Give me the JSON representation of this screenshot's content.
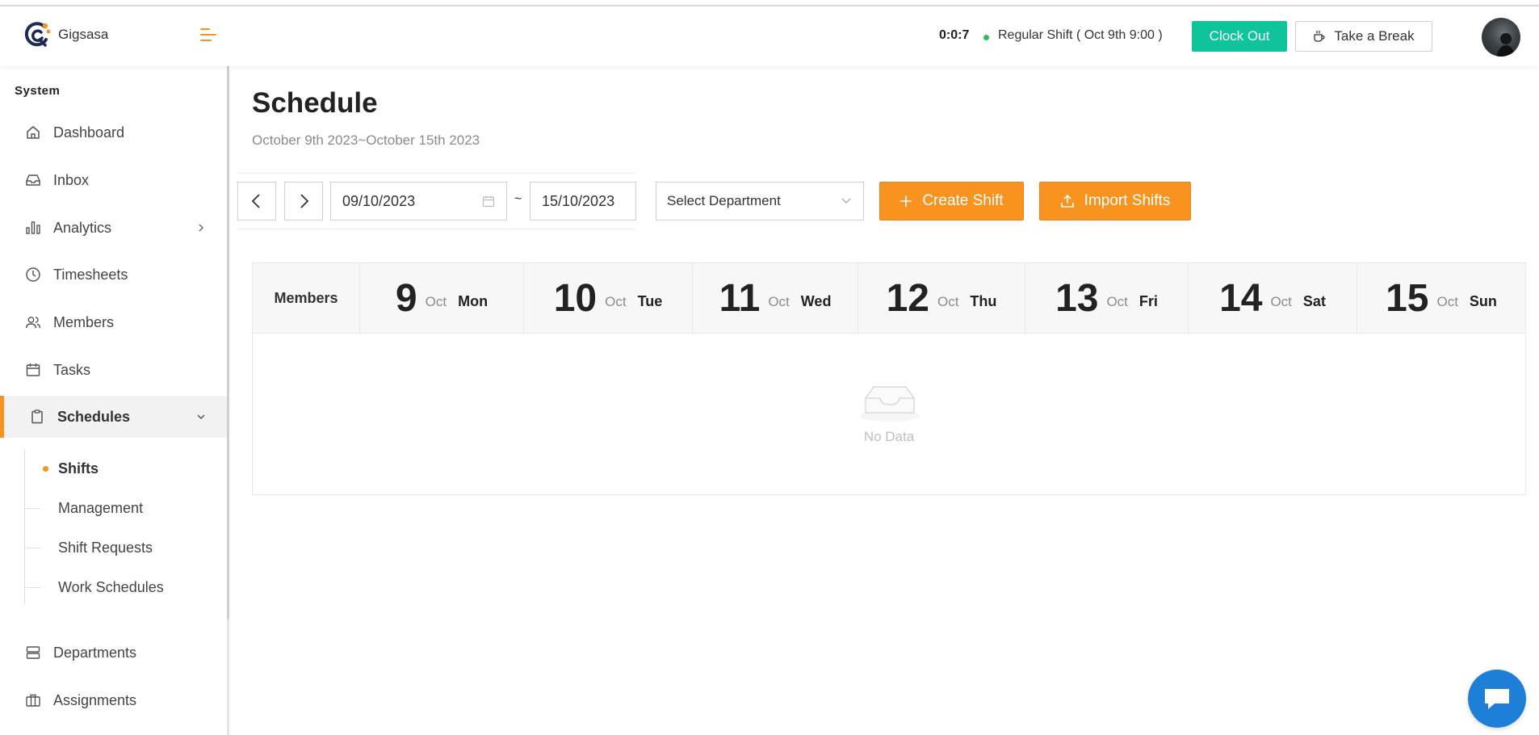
{
  "header": {
    "app_name": "Gigsasa",
    "timer": "0:0:7",
    "shift_label": "Regular Shift ( Oct 9th 9:00 )",
    "clock_out_label": "Clock Out",
    "take_break_label": "Take a Break",
    "accent": "#f7931e",
    "clock_out_color": "#0fc39b"
  },
  "sidebar": {
    "heading": "System",
    "items": [
      {
        "label": "Dashboard",
        "icon": "home-icon"
      },
      {
        "label": "Inbox",
        "icon": "inbox-icon"
      },
      {
        "label": "Analytics",
        "icon": "bar-chart-icon"
      },
      {
        "label": "Timesheets",
        "icon": "clock-icon"
      },
      {
        "label": "Members",
        "icon": "users-icon"
      },
      {
        "label": "Tasks",
        "icon": "calendar-icon"
      },
      {
        "label": "Schedules",
        "icon": "clipboard-icon"
      },
      {
        "label": "Departments",
        "icon": "server-icon"
      },
      {
        "label": "Assignments",
        "icon": "briefcase-icon"
      }
    ],
    "schedules_sub": [
      {
        "label": "Shifts"
      },
      {
        "label": "Management"
      },
      {
        "label": "Shift Requests"
      },
      {
        "label": "Work Schedules"
      }
    ]
  },
  "main": {
    "title": "Schedule",
    "date_range": "October 9th 2023~October 15th 2023",
    "start_date": "09/10/2023",
    "end_date": "15/10/2023",
    "range_separator": "~",
    "department_placeholder": "Select Department",
    "create_shift_label": "Create Shift",
    "import_shifts_label": "Import Shifts"
  },
  "table": {
    "members_header": "Members",
    "days": [
      {
        "num": "9",
        "month": "Oct",
        "name": "Mon"
      },
      {
        "num": "10",
        "month": "Oct",
        "name": "Tue"
      },
      {
        "num": "11",
        "month": "Oct",
        "name": "Wed"
      },
      {
        "num": "12",
        "month": "Oct",
        "name": "Thu"
      },
      {
        "num": "13",
        "month": "Oct",
        "name": "Fri"
      },
      {
        "num": "14",
        "month": "Oct",
        "name": "Sat"
      },
      {
        "num": "15",
        "month": "Oct",
        "name": "Sun"
      }
    ],
    "empty_text": "No Data"
  }
}
